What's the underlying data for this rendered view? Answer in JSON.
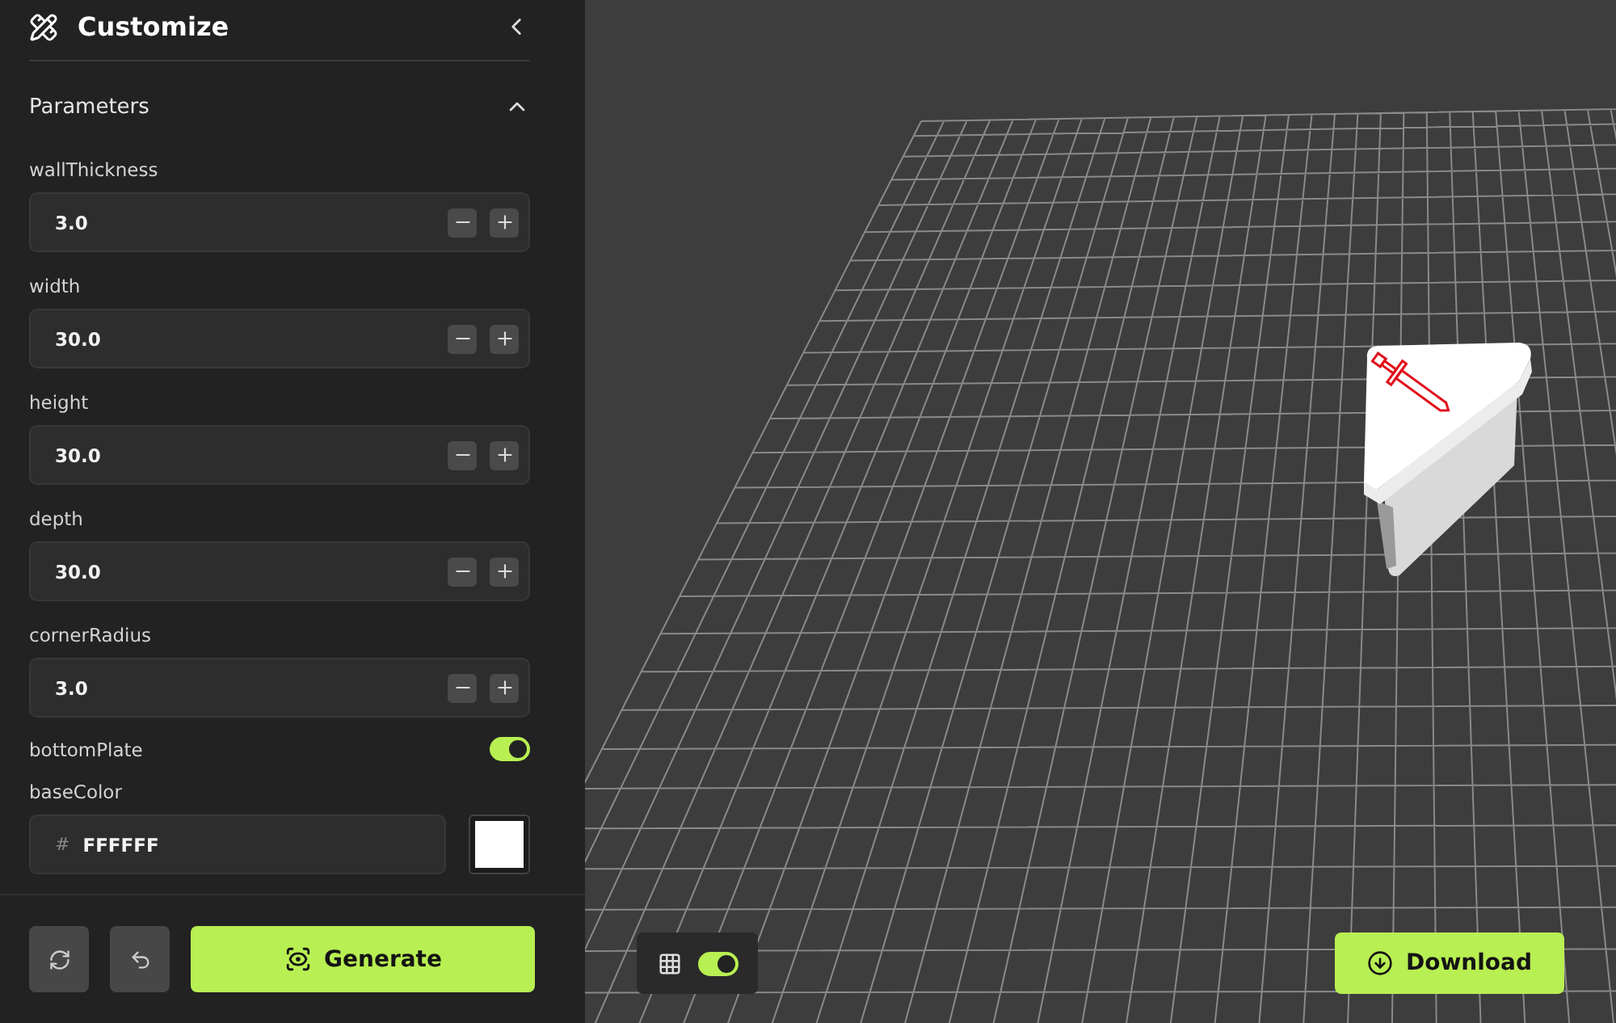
{
  "sidebar": {
    "title": "Customize",
    "section": {
      "title": "Parameters",
      "expanded": true
    },
    "params": [
      {
        "kind": "number",
        "label": "wallThickness",
        "value": "3.0"
      },
      {
        "kind": "number",
        "label": "width",
        "value": "30.0"
      },
      {
        "kind": "number",
        "label": "height",
        "value": "30.0"
      },
      {
        "kind": "number",
        "label": "depth",
        "value": "30.0"
      },
      {
        "kind": "number",
        "label": "cornerRadius",
        "value": "3.0"
      },
      {
        "kind": "toggle",
        "label": "bottomPlate",
        "on": true
      },
      {
        "kind": "color",
        "label": "baseColor",
        "prefix": "#",
        "value": "FFFFFF"
      }
    ],
    "generate": "Generate"
  },
  "viewport": {
    "grid_toggle": {
      "on": true
    },
    "download": "Download"
  }
}
